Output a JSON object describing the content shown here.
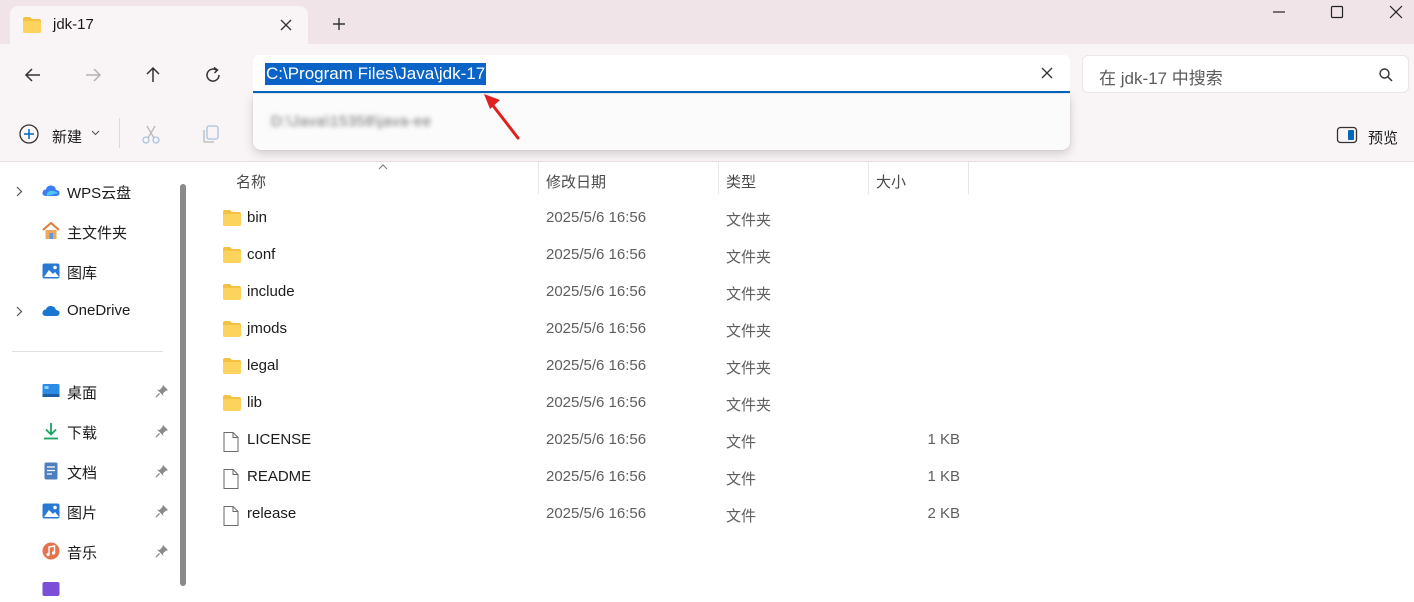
{
  "tab": {
    "title": "jdk-17"
  },
  "address": {
    "path": "C:\\Program Files\\Java\\jdk-17",
    "suggestion": "D:\\Java\\15358\\java-ee"
  },
  "search": {
    "placeholder": "在 jdk-17 中搜索"
  },
  "toolbar": {
    "new_label": "新建",
    "preview_label": "预览"
  },
  "sidebar": {
    "items": [
      {
        "label": "WPS云盘",
        "icon": "wps-cloud-icon",
        "expandable": true
      },
      {
        "label": "主文件夹",
        "icon": "home-icon",
        "expandable": false
      },
      {
        "label": "图库",
        "icon": "gallery-icon",
        "expandable": false
      },
      {
        "label": "OneDrive",
        "icon": "onedrive-icon",
        "expandable": true
      }
    ],
    "pinned": [
      {
        "label": "桌面",
        "icon": "desktop-icon"
      },
      {
        "label": "下载",
        "icon": "download-icon"
      },
      {
        "label": "文档",
        "icon": "documents-icon"
      },
      {
        "label": "图片",
        "icon": "pictures-icon"
      },
      {
        "label": "音乐",
        "icon": "music-icon"
      }
    ]
  },
  "columns": {
    "name": "名称",
    "modified": "修改日期",
    "type": "类型",
    "size": "大小"
  },
  "files": [
    {
      "name": "bin",
      "date": "2025/5/6 16:56",
      "type": "文件夹",
      "size": "",
      "kind": "folder"
    },
    {
      "name": "conf",
      "date": "2025/5/6 16:56",
      "type": "文件夹",
      "size": "",
      "kind": "folder"
    },
    {
      "name": "include",
      "date": "2025/5/6 16:56",
      "type": "文件夹",
      "size": "",
      "kind": "folder"
    },
    {
      "name": "jmods",
      "date": "2025/5/6 16:56",
      "type": "文件夹",
      "size": "",
      "kind": "folder"
    },
    {
      "name": "legal",
      "date": "2025/5/6 16:56",
      "type": "文件夹",
      "size": "",
      "kind": "folder"
    },
    {
      "name": "lib",
      "date": "2025/5/6 16:56",
      "type": "文件夹",
      "size": "",
      "kind": "folder"
    },
    {
      "name": "LICENSE",
      "date": "2025/5/6 16:56",
      "type": "文件",
      "size": "1 KB",
      "kind": "file"
    },
    {
      "name": "README",
      "date": "2025/5/6 16:56",
      "type": "文件",
      "size": "1 KB",
      "kind": "file"
    },
    {
      "name": "release",
      "date": "2025/5/6 16:56",
      "type": "文件",
      "size": "2 KB",
      "kind": "file"
    }
  ],
  "colors": {
    "accent": "#0067c0",
    "selection": "#0a63c7",
    "folder": "#f5c142",
    "annotation": "#e02020"
  }
}
